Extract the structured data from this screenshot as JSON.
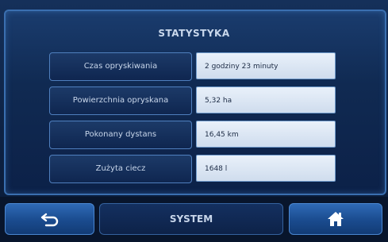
{
  "header": {
    "title": "STATYSTYKA"
  },
  "stats": [
    {
      "label": "Czas opryskiwania",
      "value": "2 godziny 23 minuty"
    },
    {
      "label": "Powierzchnia opryskana",
      "value": "5,32 ha"
    },
    {
      "label": "Pokonany dystans",
      "value": "16,45 km"
    },
    {
      "label": "Zużyta ciecz",
      "value": "1648 l"
    }
  ],
  "footer": {
    "back_icon": "back-arrow-icon",
    "system_label": "SYSTEM",
    "home_icon": "home-icon"
  },
  "colors": {
    "panel": "#102a52",
    "value_box": "#dfe9f5",
    "button_accent": "#2f6ab6"
  }
}
